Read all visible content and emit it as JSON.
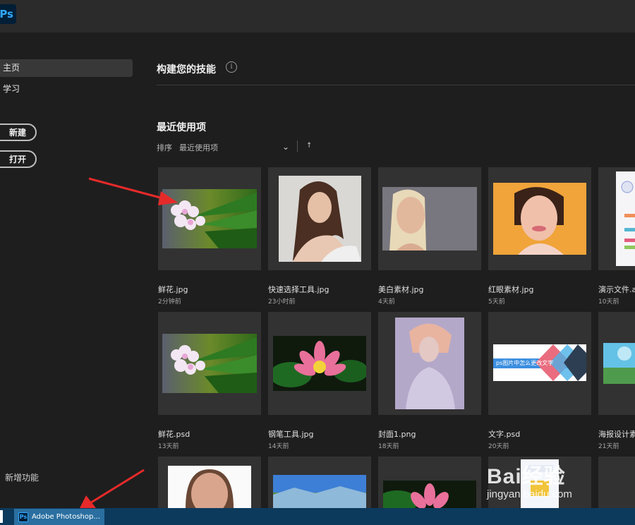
{
  "app": {
    "logo": "Ps",
    "accent": "#31a8ff"
  },
  "sidebar": {
    "items": [
      {
        "label": "主页",
        "active": true
      },
      {
        "label": "学习",
        "active": false
      }
    ],
    "new_button": "新建",
    "open_button": "打开",
    "whats_new": "新增功能"
  },
  "main": {
    "skills_title": "构建您的技能",
    "info_icon": "i",
    "recent_title": "最近使用项",
    "sort_label": "排序",
    "sort_value": "最近使用项",
    "chevron": "⌄",
    "sort_arrow": "↑",
    "files": [
      {
        "name": "鲜花.jpg",
        "time": "2分钟前"
      },
      {
        "name": "快速选择工具.jpg",
        "time": "23小时前"
      },
      {
        "name": "美白素材.jpg",
        "time": "4天前"
      },
      {
        "name": "红眼素材.jpg",
        "time": "5天前"
      },
      {
        "name": "演示文件.a",
        "time": "10天前"
      },
      {
        "name": "鲜花.psd",
        "time": "13天前"
      },
      {
        "name": "钢笔工具.jpg",
        "time": "14天前"
      },
      {
        "name": "封面1.png",
        "time": "18天前"
      },
      {
        "name": "文字.psd",
        "time": "20天前"
      },
      {
        "name": "海报设计素",
        "time": "21天前"
      }
    ],
    "text_in_thumb": "ps图片中怎么更改文字"
  },
  "taskbar": {
    "app_label": "Adobe Photoshop...",
    "app_icon": "Ps"
  },
  "watermark": {
    "brand": "Bai经验",
    "url": "jingyan.baidu.com"
  }
}
